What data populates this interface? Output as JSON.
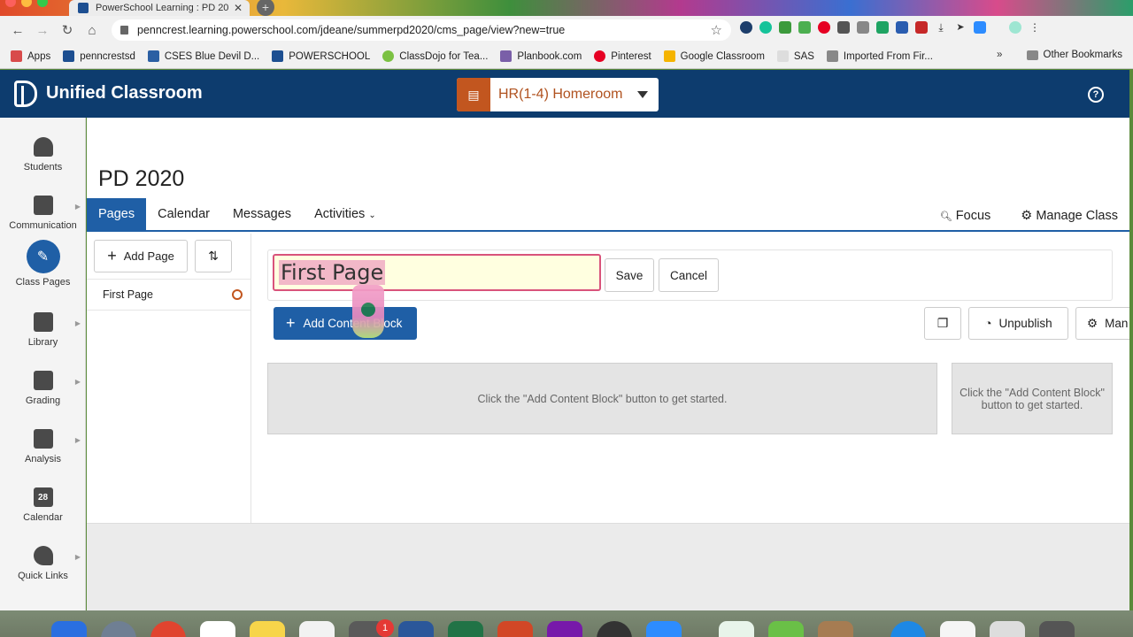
{
  "browser": {
    "tab_title": "PowerSchool Learning : PD 20",
    "url": "penncrest.learning.powerschool.com/jdeane/summerpd2020/cms_page/view?new=true",
    "bookmarks": [
      "Apps",
      "penncrestsd",
      "CSES Blue Devil D...",
      "POWERSCHOOL",
      "ClassDojo for Tea...",
      "Planbook.com",
      "Pinterest",
      "Google Classroom",
      "SAS",
      "Imported From Fir..."
    ],
    "other_bookmarks": "Other Bookmarks",
    "more": "»"
  },
  "app": {
    "title": "Unified Classroom",
    "class_selector": "HR(1-4) Homeroom",
    "help": "?"
  },
  "sidenav": {
    "items": [
      {
        "label": "Students"
      },
      {
        "label": "Communication"
      },
      {
        "label": "Class Pages"
      },
      {
        "label": "Library"
      },
      {
        "label": "Grading"
      },
      {
        "label": "Analysis"
      },
      {
        "label": "Calendar"
      },
      {
        "label": "Quick Links"
      }
    ],
    "calendar_day": "28"
  },
  "main": {
    "page_title": "PD 2020",
    "tabs": [
      "Pages",
      "Calendar",
      "Messages",
      "Activities"
    ],
    "focus": "Focus",
    "manage_class": "Manage Class",
    "add_page": "Add Page",
    "pages": [
      {
        "label": "First Page"
      }
    ],
    "title_input_value": "First Page",
    "save": "Save",
    "cancel": "Cancel",
    "add_content_block": "Add Content Block",
    "unpublish": "Unpublish",
    "manage_truncated": "Man",
    "empty_main": "Click the \"Add Content Block\" button to get started.",
    "empty_side": "Click the \"Add Content Block\" button to get started."
  },
  "dock": {
    "badge": "1"
  },
  "colors": {
    "brand": "#0d3c6e",
    "primary": "#1f5fa6",
    "accent": "#c2561f"
  }
}
